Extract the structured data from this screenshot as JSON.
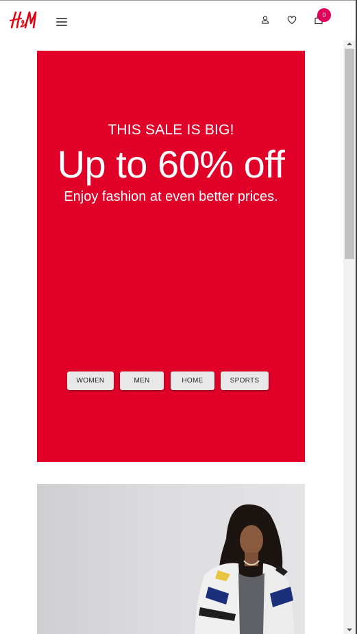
{
  "header": {
    "logo_text": "H&M",
    "menu_icon": "hamburger-menu-icon",
    "account_icon": "account-icon",
    "wishlist_icon": "heart-icon",
    "bag_icon": "shopping-bag-icon",
    "cart_count": "0"
  },
  "hero": {
    "eyebrow": "THIS SALE IS BIG!",
    "headline": "Up to 60% off",
    "subtext": "Enjoy fashion at even better prices.",
    "buttons": {
      "women": "WOMEN",
      "men": "MEN",
      "home": "HOME",
      "sports": "SPORTS"
    }
  },
  "colors": {
    "brand_red": "#e00028",
    "badge_pink": "#e2005a",
    "logo_red": "#e50010"
  },
  "promo": {
    "image": "model-in-racing-jacket-photo"
  }
}
